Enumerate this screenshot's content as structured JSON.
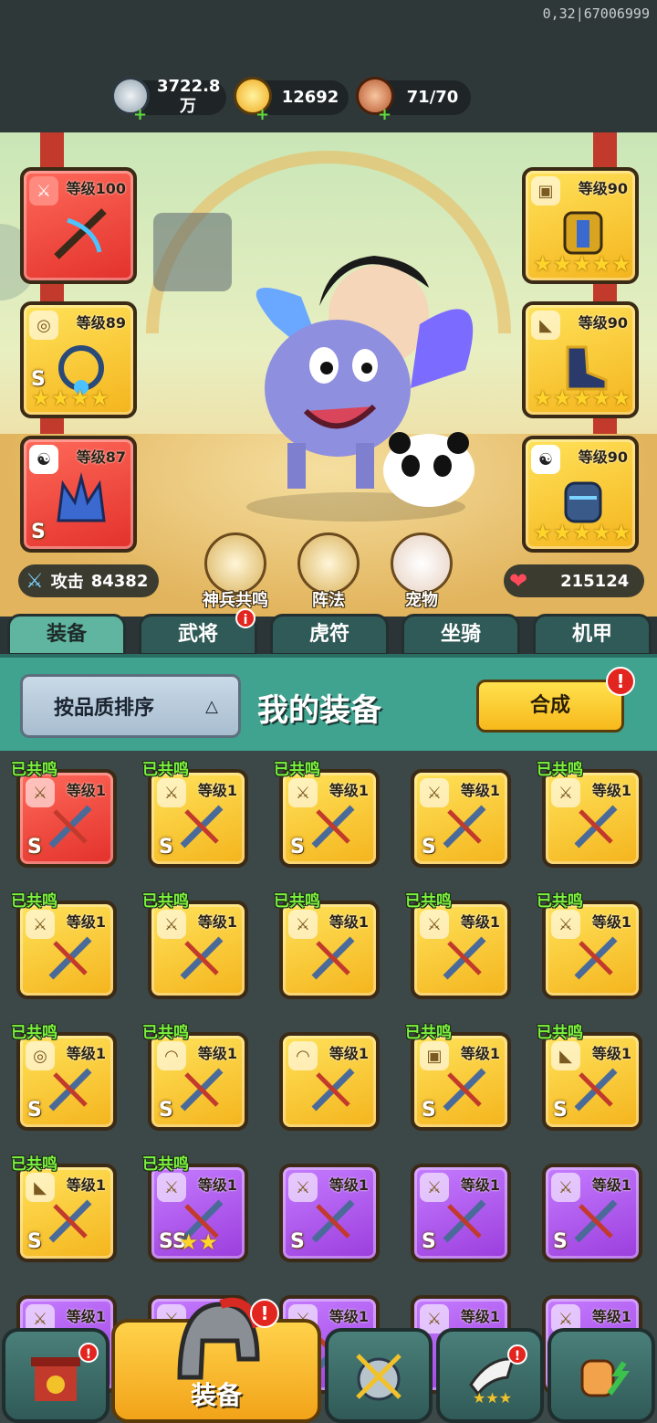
{
  "debug_text": "0,32|67006999",
  "resources": [
    {
      "icon": "silver-coin-icon",
      "value": "3722.8\n万"
    },
    {
      "icon": "gold-ingot-icon",
      "value": "12692"
    },
    {
      "icon": "meat-drumstick-icon",
      "value": "71/70"
    }
  ],
  "equip_slots": {
    "left": [
      {
        "level": "等级100",
        "color": "red",
        "badge": "sword-icon",
        "grade": ""
      },
      {
        "level": "等级89",
        "color": "gold",
        "badge": "medal-icon",
        "grade": "S",
        "stars": "★★★★"
      },
      {
        "level": "等级87",
        "color": "red",
        "badge": "yin-yang-icon",
        "grade": "S"
      }
    ],
    "right": [
      {
        "level": "等级90",
        "color": "gold",
        "badge": "armor-icon",
        "stars": "★★★★★"
      },
      {
        "level": "等级90",
        "color": "gold",
        "badge": "boots-icon",
        "stars": "★★★★★"
      },
      {
        "level": "等级90",
        "color": "gold",
        "badge": "yin-yang-icon",
        "stars": "★★★★★"
      }
    ]
  },
  "stats": {
    "attack_label": "攻击",
    "attack_value": "84382",
    "hp_value": "215124"
  },
  "center_buttons": [
    "神兵共鸣",
    "阵法",
    "宠物"
  ],
  "tabs": [
    "装备",
    "武将",
    "虎符",
    "坐骑",
    "机甲"
  ],
  "sort_button": "按品质排序",
  "my_title": "我的装备",
  "synth_button": "合成",
  "resonated_label": "已共鸣",
  "grid": [
    {
      "lvl": "等级1",
      "color": "red",
      "res": true,
      "s": "S",
      "badge": "sword-icon"
    },
    {
      "lvl": "等级1",
      "color": "gold",
      "res": true,
      "s": "S",
      "badge": "sword-icon"
    },
    {
      "lvl": "等级1",
      "color": "gold",
      "res": true,
      "s": "S",
      "badge": "sword-icon"
    },
    {
      "lvl": "等级1",
      "color": "gold",
      "res": false,
      "s": "S",
      "badge": "sword-icon"
    },
    {
      "lvl": "等级1",
      "color": "gold",
      "res": true,
      "s": "",
      "badge": "sword-icon"
    },
    {
      "lvl": "等级1",
      "color": "gold",
      "res": true,
      "s": "",
      "badge": "sword-icon"
    },
    {
      "lvl": "等级1",
      "color": "gold",
      "res": true,
      "s": "",
      "badge": "sword-icon"
    },
    {
      "lvl": "等级1",
      "color": "gold",
      "res": true,
      "s": "",
      "badge": "sword-icon"
    },
    {
      "lvl": "等级1",
      "color": "gold",
      "res": true,
      "s": "",
      "badge": "sword-icon"
    },
    {
      "lvl": "等级1",
      "color": "gold",
      "res": true,
      "s": "",
      "badge": "sword-icon"
    },
    {
      "lvl": "等级1",
      "color": "gold",
      "res": true,
      "s": "S",
      "badge": "medal-icon"
    },
    {
      "lvl": "等级1",
      "color": "gold",
      "res": true,
      "s": "S",
      "badge": "helmet-icon"
    },
    {
      "lvl": "等级1",
      "color": "gold",
      "res": false,
      "s": "",
      "badge": "helmet-icon"
    },
    {
      "lvl": "等级1",
      "color": "gold",
      "res": true,
      "s": "S",
      "badge": "armor-icon"
    },
    {
      "lvl": "等级1",
      "color": "gold",
      "res": true,
      "s": "S",
      "badge": "boots-icon"
    },
    {
      "lvl": "等级1",
      "color": "gold",
      "res": true,
      "s": "S",
      "badge": "boots-icon"
    },
    {
      "lvl": "等级1",
      "color": "purple",
      "res": true,
      "s": "SS",
      "badge": "sword-icon",
      "stars": "★★"
    },
    {
      "lvl": "等级1",
      "color": "purple",
      "res": false,
      "s": "S",
      "badge": "sword-icon"
    },
    {
      "lvl": "等级1",
      "color": "purple",
      "res": false,
      "s": "S",
      "badge": "sword-icon"
    },
    {
      "lvl": "等级1",
      "color": "purple",
      "res": false,
      "s": "S",
      "badge": "sword-icon"
    },
    {
      "lvl": "等级1",
      "color": "purple",
      "res": false,
      "s": "",
      "badge": "sword-icon"
    },
    {
      "lvl": "等级",
      "color": "purple",
      "res": false,
      "s": "",
      "badge": "sword-icon"
    },
    {
      "lvl": "等级1",
      "color": "purple",
      "res": false,
      "s": "",
      "badge": "sword-icon"
    },
    {
      "lvl": "等级1",
      "color": "purple",
      "res": false,
      "s": "",
      "badge": "sword-icon"
    },
    {
      "lvl": "等级1",
      "color": "purple",
      "res": false,
      "s": "",
      "badge": "sword-icon"
    }
  ],
  "bottom_nav": [
    {
      "icon": "castle-icon",
      "label": ""
    },
    {
      "icon": "helmet-icon",
      "label": "装备"
    },
    {
      "icon": "crossed-swords-shield-icon",
      "label": ""
    },
    {
      "icon": "horn-icon",
      "label": ""
    },
    {
      "icon": "fist-upgrade-icon",
      "label": ""
    }
  ]
}
